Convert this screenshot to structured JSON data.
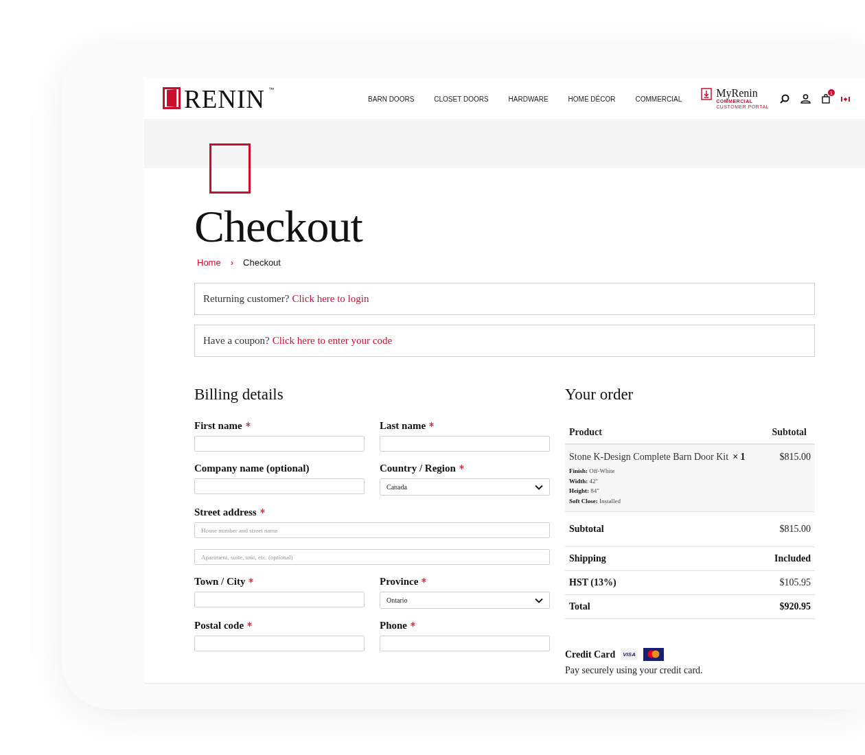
{
  "header": {
    "logo": "RENIN",
    "logo_mark": "™",
    "nav": [
      "BARN DOORS",
      "CLOSET DOORS",
      "HARDWARE",
      "HOME DÉCOR",
      "COMMERCIAL"
    ],
    "portal": {
      "name": "MyRenin",
      "line1": "COMMERCIAL",
      "line2": "CUSTOMER PORTAL"
    },
    "cart_count": "1"
  },
  "page_title": "Checkout",
  "breadcrumb": [
    {
      "label": "Home",
      "link": true
    },
    {
      "label": "Checkout",
      "link": false
    }
  ],
  "breadcrumb_separator": "›",
  "notices": [
    {
      "text": "Returning customer?",
      "link": "Click here to login"
    },
    {
      "text": "Have a coupon?",
      "link": "Click here to enter your code"
    }
  ],
  "billing": {
    "title": "Billing details",
    "rows": [
      [
        {
          "label": "First name",
          "required": true,
          "kind": "input"
        },
        {
          "label": "Last name",
          "required": true,
          "kind": "input"
        }
      ],
      [
        {
          "label": "Company name (optional)",
          "required": false,
          "kind": "input"
        },
        {
          "label": "Country / Region",
          "required": true,
          "kind": "select",
          "value": "Canada"
        }
      ],
      [
        {
          "label": "Street address",
          "required": true,
          "kind": "input",
          "placeholder": "House number and street name"
        }
      ],
      [
        {
          "kind": "input",
          "placeholder": "Apartment, suite, unit, etc. (optional)"
        }
      ],
      [
        {
          "label": "Town / City",
          "required": true,
          "kind": "input"
        },
        {
          "label": "Province",
          "required": true,
          "kind": "select",
          "value": "Ontario"
        }
      ],
      [
        {
          "label": "Postal code",
          "required": true,
          "kind": "input"
        },
        {
          "label": "Phone",
          "required": true,
          "kind": "input"
        }
      ]
    ]
  },
  "order": {
    "title": "Your order",
    "columns": [
      "Product",
      "Subtotal"
    ],
    "item": {
      "name": "Stone K-Design Complete Barn Door Kit",
      "qty": "× 1",
      "price": "$815.00",
      "meta": [
        {
          "key": "Finish:",
          "value": "Off-White"
        },
        {
          "key": "Width:",
          "value": "42\""
        },
        {
          "key": "Height:",
          "value": "84\""
        },
        {
          "key": "Soft Close:",
          "value": "Installed"
        }
      ]
    },
    "totals": [
      {
        "label": "Subtotal",
        "value": "$815.00",
        "bold_value": false
      },
      {
        "label": "Shipping",
        "value": "Included",
        "bold_value": true
      },
      {
        "label": "HST (13%)",
        "value": "$105.95",
        "bold_value": false
      },
      {
        "label": "Total",
        "value": "$920.95",
        "bold_value": true
      }
    ]
  },
  "payment": {
    "method": "Credit Card",
    "visa": "VISA",
    "description": "Pay securely using your credit card."
  }
}
